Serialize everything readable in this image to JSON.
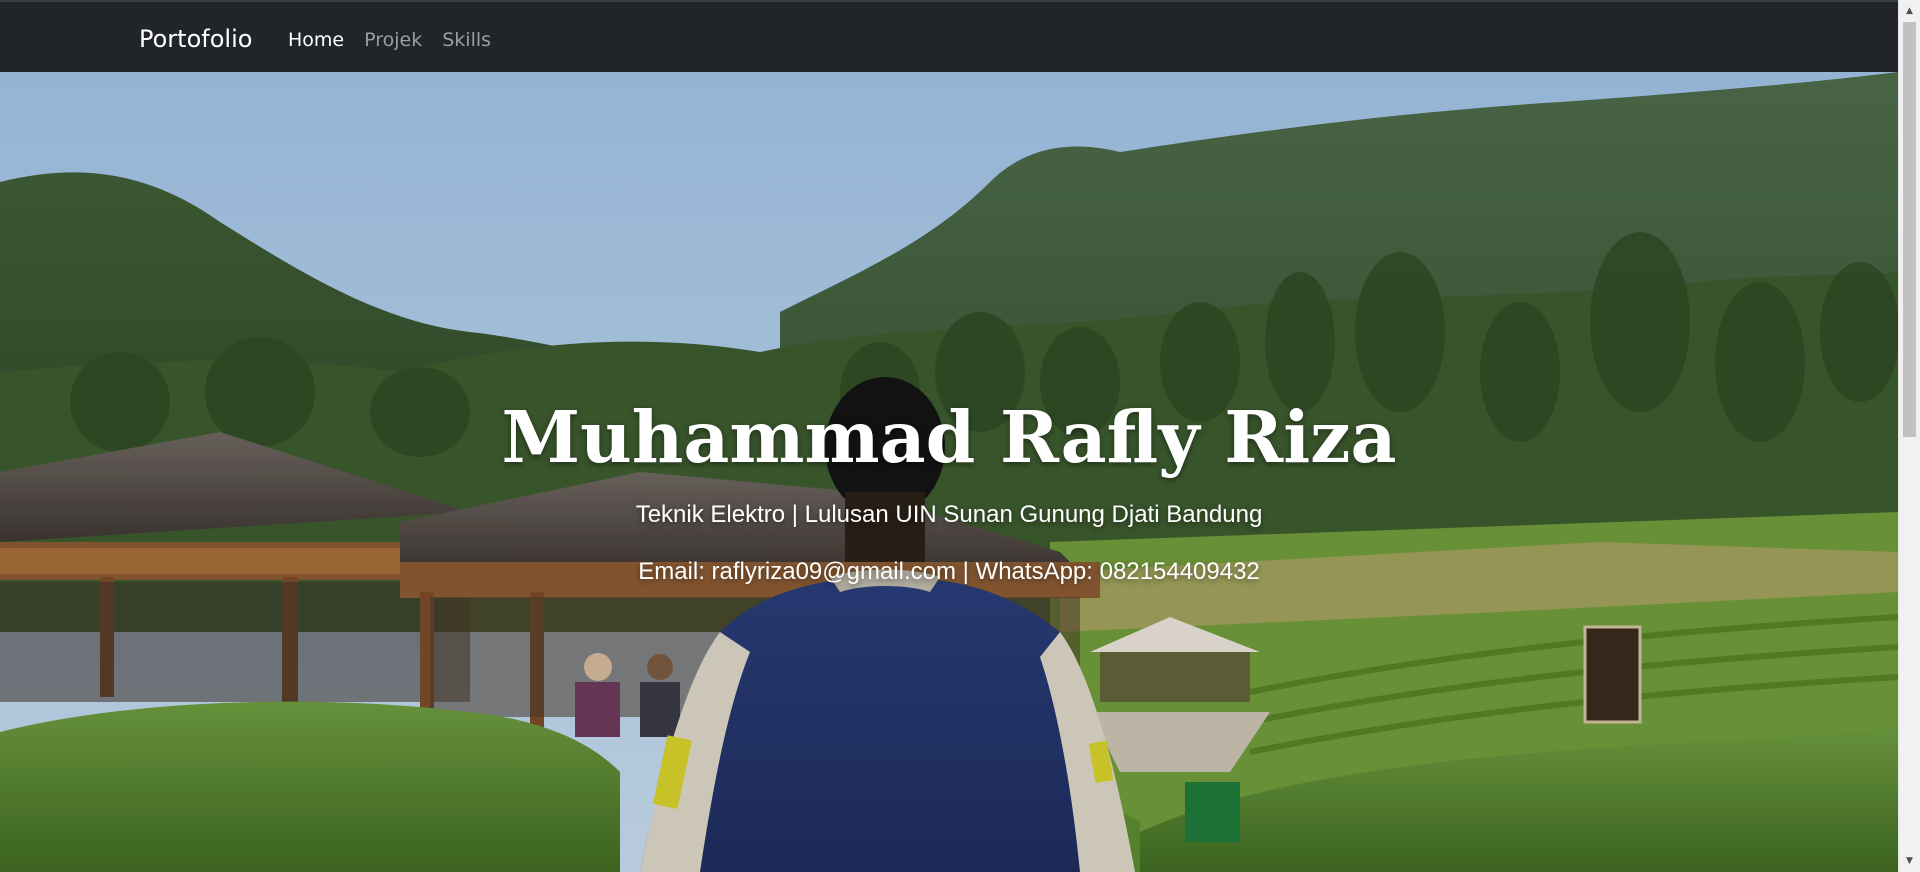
{
  "navbar": {
    "brand": "Portofolio",
    "links": [
      {
        "label": "Home",
        "active": true
      },
      {
        "label": "Projek",
        "active": false
      },
      {
        "label": "Skills",
        "active": false
      }
    ]
  },
  "hero": {
    "title": "Muhammad Rafly Riza",
    "subtitle": "Teknik Elektro | Lulusan UIN Sunan Gunung Djati Bandung",
    "contact": "Email: raflyriza09@gmail.com | WhatsApp: 082154409432",
    "background": "photo of a man in a navy varsity jacket facing forested mountains, tea gardens and wooden gazebos"
  },
  "colors": {
    "navbar_bg": "#212529",
    "nav_active": "#ffffff",
    "nav_inactive": "#8c8f93",
    "hero_text": "#ffffff"
  },
  "icons": [
    "scroll-up-arrow-icon",
    "scroll-down-arrow-icon"
  ]
}
